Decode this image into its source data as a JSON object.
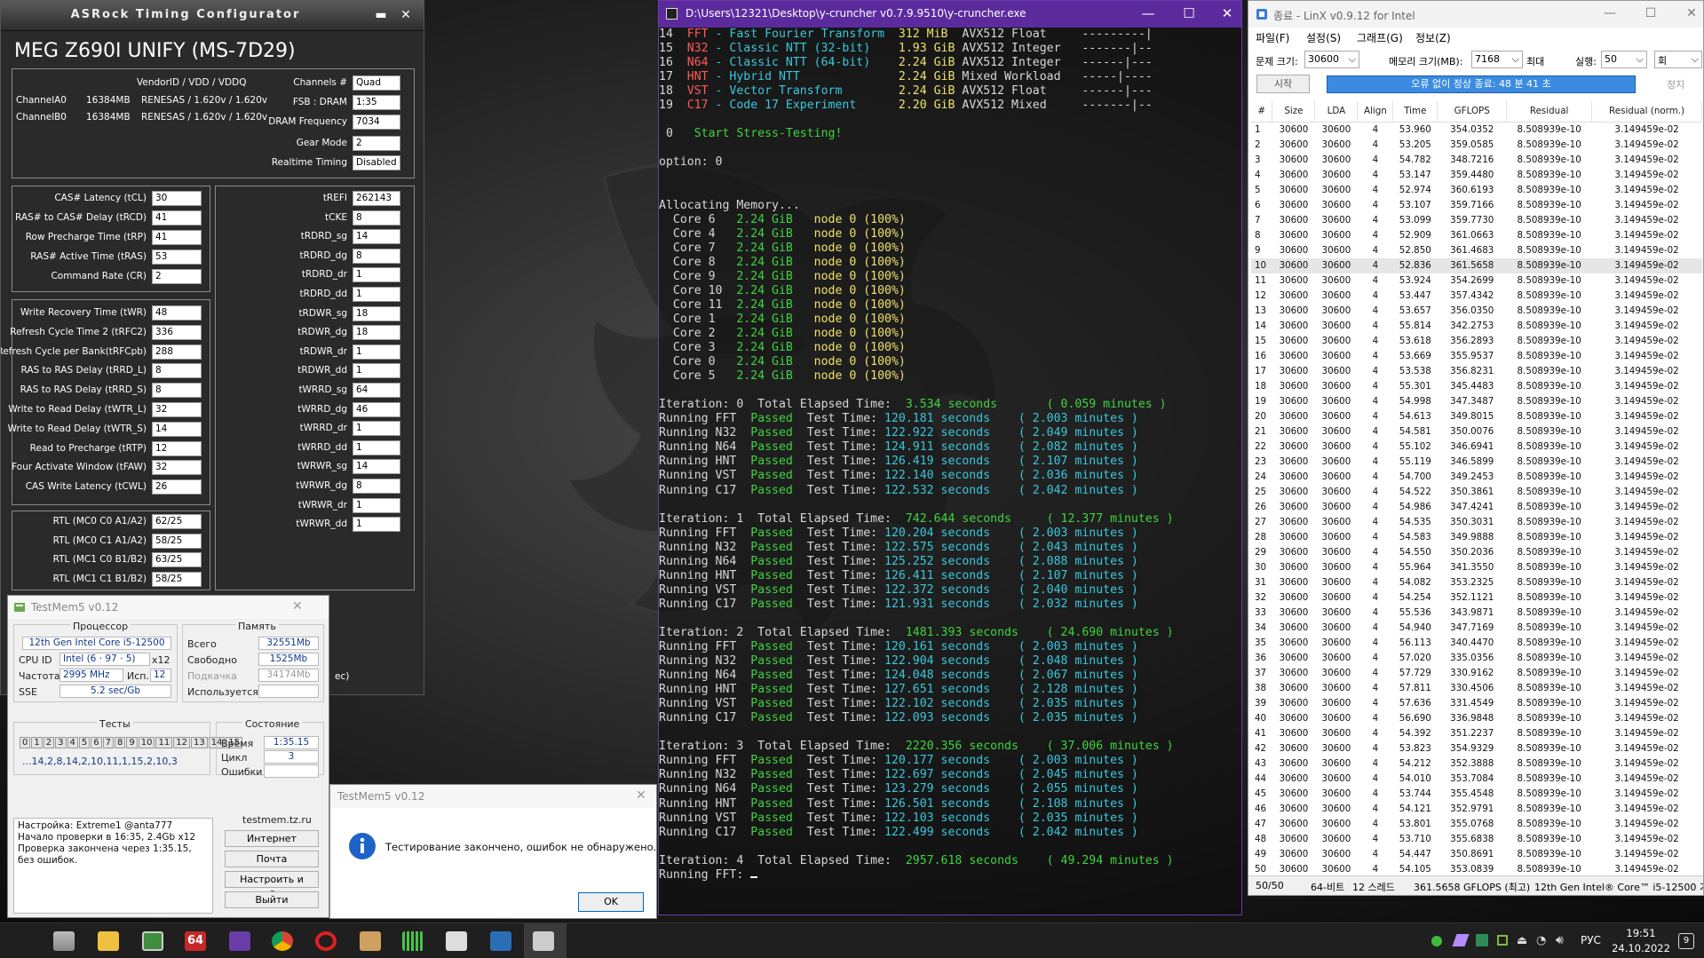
{
  "asrock": {
    "window_title": "ASRock Timing Configurator",
    "board": "MEG Z690I UNIFY (MS-7D29)",
    "vendor_header": "VendorID / VDD / VDDQ",
    "channels": [
      {
        "name": "ChannelA0",
        "size": "16384MB",
        "vendor": "RENESAS / 1.620v / 1.620v"
      },
      {
        "name": "ChannelB0",
        "size": "16384MB",
        "vendor": "RENESAS / 1.620v / 1.620v"
      }
    ],
    "top_fields": [
      {
        "label": "Channels #",
        "value": "Quad"
      },
      {
        "label": "FSB : DRAM",
        "value": "1:35"
      },
      {
        "label": "DRAM Frequency",
        "value": "7034"
      },
      {
        "label": "Gear Mode",
        "value": "2"
      },
      {
        "label": "Realtime Timing",
        "value": "Disabled"
      }
    ],
    "primary": [
      {
        "label": "CAS# Latency (tCL)",
        "value": "30"
      },
      {
        "label": "RAS# to CAS# Delay (tRCD)",
        "value": "41"
      },
      {
        "label": "Row Precharge Time (tRP)",
        "value": "41"
      },
      {
        "label": "RAS# Active Time (tRAS)",
        "value": "53"
      },
      {
        "label": "Command Rate (CR)",
        "value": "2"
      }
    ],
    "secondary": [
      {
        "label": "Write Recovery Time (tWR)",
        "value": "48"
      },
      {
        "label": "Refresh Cycle Time 2 (tRFC2)",
        "value": "336"
      },
      {
        "label": "Refresh Cycle per Bank(tRFCpb)",
        "value": "288"
      },
      {
        "label": "RAS to RAS Delay (tRRD_L)",
        "value": "8"
      },
      {
        "label": "RAS to RAS Delay (tRRD_S)",
        "value": "8"
      },
      {
        "label": "Write to Read Delay (tWTR_L)",
        "value": "32"
      },
      {
        "label": "Write to Read Delay (tWTR_S)",
        "value": "14"
      },
      {
        "label": "Read to Precharge (tRTP)",
        "value": "12"
      },
      {
        "label": "Four Activate Window (tFAW)",
        "value": "32"
      },
      {
        "label": "CAS Write Latency (tCWL)",
        "value": "26"
      }
    ],
    "rtl": [
      {
        "label": "RTL (MC0 C0 A1/A2)",
        "value": "62/25"
      },
      {
        "label": "RTL (MC0 C1 A1/A2)",
        "value": "58/25"
      },
      {
        "label": "RTL (MC1 C0 B1/B2)",
        "value": "63/25"
      },
      {
        "label": "RTL (MC1 C1 B1/B2)",
        "value": "58/25"
      }
    ],
    "right": [
      {
        "label": "tREFI",
        "value": "262143"
      },
      {
        "label": "tCKE",
        "value": "8"
      },
      {
        "label": "tRDRD_sg",
        "value": "14"
      },
      {
        "label": "tRDRD_dg",
        "value": "8"
      },
      {
        "label": "tRDRD_dr",
        "value": "1"
      },
      {
        "label": "tRDRD_dd",
        "value": "1"
      },
      {
        "label": "tRDWR_sg",
        "value": "18"
      },
      {
        "label": "tRDWR_dg",
        "value": "18"
      },
      {
        "label": "tRDWR_dr",
        "value": "1"
      },
      {
        "label": "tRDWR_dd",
        "value": "1"
      },
      {
        "label": "tWRRD_sg",
        "value": "64"
      },
      {
        "label": "tWRRD_dg",
        "value": "46"
      },
      {
        "label": "tWRRD_dr",
        "value": "1"
      },
      {
        "label": "tWRRD_dd",
        "value": "1"
      },
      {
        "label": "tWRWR_sg",
        "value": "14"
      },
      {
        "label": "tWRWR_dg",
        "value": "8"
      },
      {
        "label": "tWRWR_dr",
        "value": "1"
      },
      {
        "label": "tWRWR_dd",
        "value": "1"
      }
    ],
    "bottom_fragment": "ec)"
  },
  "ycruncher": {
    "title": "D:\\Users\\12321\\Desktop\\y-cruncher v0.7.9.9510\\y-cruncher.exe",
    "tests": [
      [
        "14",
        "FFT",
        "- Fast Fourier Transform",
        "312 MiB",
        "AVX512 Float",
        "---------|"
      ],
      [
        "15",
        "N32",
        "- Classic NTT (32-bit)",
        "1.93 GiB",
        "AVX512 Integer",
        "-------|--"
      ],
      [
        "16",
        "N64",
        "- Classic NTT (64-bit)",
        "2.24 GiB",
        "AVX512 Integer",
        "------|---"
      ],
      [
        "17",
        "HNT",
        "- Hybrid NTT",
        "2.24 GiB",
        "Mixed Workload",
        "-----|----"
      ],
      [
        "18",
        "VST",
        "- Vector Transform",
        "2.24 GiB",
        "AVX512 Float",
        "------|---"
      ],
      [
        "19",
        "C17",
        "- Code 17 Experiment",
        "2.20 GiB",
        "AVX512 Mixed",
        "-------|--"
      ]
    ],
    "start_num": "0",
    "start_text": "Start Stress-Testing!",
    "option": "option: 0",
    "alloc": "Allocating Memory...",
    "cores": [
      [
        "6",
        "2.24 GiB",
        "node 0 (100%)"
      ],
      [
        "4",
        "2.24 GiB",
        "node 0 (100%)"
      ],
      [
        "7",
        "2.24 GiB",
        "node 0 (100%)"
      ],
      [
        "8",
        "2.24 GiB",
        "node 0 (100%)"
      ],
      [
        "9",
        "2.24 GiB",
        "node 0 (100%)"
      ],
      [
        "10",
        "2.24 GiB",
        "node 0 (100%)"
      ],
      [
        "11",
        "2.24 GiB",
        "node 0 (100%)"
      ],
      [
        "1",
        "2.24 GiB",
        "node 0 (100%)"
      ],
      [
        "2",
        "2.24 GiB",
        "node 0 (100%)"
      ],
      [
        "3",
        "2.24 GiB",
        "node 0 (100%)"
      ],
      [
        "0",
        "2.24 GiB",
        "node 0 (100%)"
      ],
      [
        "5",
        "2.24 GiB",
        "node 0 (100%)"
      ]
    ],
    "iterations": [
      {
        "n": "0",
        "elapsed": "3.534 seconds",
        "mins": "( 0.059 minutes )",
        "runs": [
          [
            "FFT",
            "120.181 seconds",
            "( 2.003 minutes )"
          ],
          [
            "N32",
            "122.922 seconds",
            "( 2.049 minutes )"
          ],
          [
            "N64",
            "124.911 seconds",
            "( 2.082 minutes )"
          ],
          [
            "HNT",
            "126.419 seconds",
            "( 2.107 minutes )"
          ],
          [
            "VST",
            "122.140 seconds",
            "( 2.036 minutes )"
          ],
          [
            "C17",
            "122.532 seconds",
            "( 2.042 minutes )"
          ]
        ]
      },
      {
        "n": "1",
        "elapsed": "742.644 seconds",
        "mins": "( 12.377 minutes )",
        "runs": [
          [
            "FFT",
            "120.204 seconds",
            "( 2.003 minutes )"
          ],
          [
            "N32",
            "122.575 seconds",
            "( 2.043 minutes )"
          ],
          [
            "N64",
            "125.252 seconds",
            "( 2.088 minutes )"
          ],
          [
            "HNT",
            "126.411 seconds",
            "( 2.107 minutes )"
          ],
          [
            "VST",
            "122.372 seconds",
            "( 2.040 minutes )"
          ],
          [
            "C17",
            "121.931 seconds",
            "( 2.032 minutes )"
          ]
        ]
      },
      {
        "n": "2",
        "elapsed": "1481.393 seconds",
        "mins": "( 24.690 minutes )",
        "runs": [
          [
            "FFT",
            "120.161 seconds",
            "( 2.003 minutes )"
          ],
          [
            "N32",
            "122.904 seconds",
            "( 2.048 minutes )"
          ],
          [
            "N64",
            "124.048 seconds",
            "( 2.067 minutes )"
          ],
          [
            "HNT",
            "127.651 seconds",
            "( 2.128 minutes )"
          ],
          [
            "VST",
            "122.102 seconds",
            "( 2.035 minutes )"
          ],
          [
            "C17",
            "122.093 seconds",
            "( 2.035 minutes )"
          ]
        ]
      },
      {
        "n": "3",
        "elapsed": "2220.356 seconds",
        "mins": "( 37.006 minutes )",
        "runs": [
          [
            "FFT",
            "120.177 seconds",
            "( 2.003 minutes )"
          ],
          [
            "N32",
            "122.697 seconds",
            "( 2.045 minutes )"
          ],
          [
            "N64",
            "123.279 seconds",
            "( 2.055 minutes )"
          ],
          [
            "HNT",
            "126.501 seconds",
            "( 2.108 minutes )"
          ],
          [
            "VST",
            "122.103 seconds",
            "( 2.035 minutes )"
          ],
          [
            "C17",
            "122.499 seconds",
            "( 2.042 minutes )"
          ]
        ]
      }
    ],
    "last_iter": {
      "n": "4",
      "elapsed": "2957.618 seconds",
      "mins": "( 49.294 minutes )"
    },
    "last_running": "Running FFT:",
    "kw": {
      "iteration": "Iteration:",
      "total": "Total Elapsed Time:",
      "running": "Running",
      "passed": "Passed",
      "test_time": "Test Time:",
      "core": "Core"
    }
  },
  "linx": {
    "title": "종료 - LinX v0.9.12 for Intel",
    "menu": [
      "파일(F)",
      "설정(S)",
      "그래프(G)",
      "정보(Z)"
    ],
    "problem_label": "문제 크기:",
    "problem_value": "30600",
    "memory_label": "메모리 크기(MB):",
    "memory_value": "7168",
    "max_label": "최대",
    "run_label": "실행:",
    "run_value": "50",
    "run_unit": "회",
    "start_btn": "시작",
    "status": "오류 없이 정상 종료: 48 분 41 초",
    "stop_btn": "정지",
    "headers": [
      "#",
      "Size",
      "LDA",
      "Align",
      "Time",
      "GFLOPS",
      "Residual",
      "Residual (norm.)"
    ],
    "residual": "8.508939e-10",
    "residual_norm": "3.149459e-02",
    "size": "30600",
    "lda": "30600",
    "align": "4",
    "times": [
      "53.960",
      "53.205",
      "54.782",
      "53.147",
      "52.974",
      "53.107",
      "53.099",
      "52.909",
      "52.850",
      "52.836",
      "53.924",
      "53.447",
      "53.657",
      "55.814",
      "53.618",
      "53.669",
      "53.538",
      "55.301",
      "54.998",
      "54.613",
      "54.581",
      "55.102",
      "55.119",
      "54.700",
      "54.522",
      "54.986",
      "54.535",
      "54.583",
      "54.550",
      "55.964",
      "54.082",
      "54.254",
      "55.536",
      "54.940",
      "56.113",
      "57.020",
      "57.729",
      "57.811",
      "57.636",
      "56.690",
      "54.392",
      "53.823",
      "54.212",
      "54.010",
      "53.744",
      "54.121",
      "53.801",
      "53.710",
      "54.447",
      "54.105"
    ],
    "gflops": [
      "354.0352",
      "359.0585",
      "348.7216",
      "359.4480",
      "360.6193",
      "359.7166",
      "359.7730",
      "361.0663",
      "361.4683",
      "361.5658",
      "354.2699",
      "357.4342",
      "356.0350",
      "342.2753",
      "356.2893",
      "355.9537",
      "356.8231",
      "345.4483",
      "347.3487",
      "349.8015",
      "350.0076",
      "346.6941",
      "346.5899",
      "349.2453",
      "350.3861",
      "347.4241",
      "350.3031",
      "349.9888",
      "350.2036",
      "341.3550",
      "353.2325",
      "352.1121",
      "343.9871",
      "347.7169",
      "340.4470",
      "335.0356",
      "330.9162",
      "330.4506",
      "331.4549",
      "336.9848",
      "351.2237",
      "354.9329",
      "352.3888",
      "353.7084",
      "355.4548",
      "352.9791",
      "355.0768",
      "355.6838",
      "350.8691",
      "353.0839"
    ],
    "highlight_row": 10,
    "statusbar": [
      "50/50",
      "64-비트",
      "12 스레드",
      "361.5658 GFLOPS (최고)",
      "12th Gen Intel® Core™ i5-12500 기록"
    ]
  },
  "testmem": {
    "title": "TestMem5 v0.12",
    "cpu_header": "Процессор",
    "cpu_name": "12th Gen Intel Core i5-12500",
    "cpuid_label": "CPU ID",
    "cpuid_value": "Intel (6 · 97 · 5)",
    "cpuid_x": "x12",
    "freq_label": "Частота",
    "freq_value": "2995 MHz",
    "use_label": "Исп.",
    "use_value": "12",
    "sse_label": "SSE",
    "sse_value": "5.2 sec/Gb",
    "mem_header": "Память",
    "total_label": "Всего",
    "total_value": "32551Mb",
    "free_label": "Свободно",
    "free_value": "1525Mb",
    "swap_label": "Подкачка",
    "swap_value": "34174Mb",
    "used_label": "Используется",
    "tests_header": "Тесты",
    "test_nums": [
      "0",
      "1",
      "2",
      "3",
      "4",
      "5",
      "6",
      "7",
      "8",
      "9",
      "10",
      "11",
      "12",
      "13",
      "14",
      "15"
    ],
    "sequence": "...14,2,8,14,2,10,11,1,15,2,10,3",
    "state_header": "Состояние",
    "time_label": "Время",
    "time_value": "1:35.15",
    "cycle_label": "Цикл",
    "cycle_value": "3",
    "errors_label": "Ошибки",
    "log": [
      "Настройка: Extreme1 @anta777",
      "Начало проверки в 16:35, 2.4Gb x12",
      "Проверка закончена через 1:35.15,",
      "без ошибок."
    ],
    "site": "testmem.tz.ru",
    "buttons": [
      "Интернет",
      "Почта",
      "Настроить и выйти",
      "Выйти"
    ]
  },
  "dialog": {
    "title": "TestMem5 v0.12",
    "message": "Тестирование закончено, ошибок не обнаружено.",
    "ok": "OK"
  },
  "taskbar": {
    "lang": "РУС",
    "time": "19:51",
    "date": "24.10.2022",
    "badge": "64",
    "notif": "9"
  }
}
